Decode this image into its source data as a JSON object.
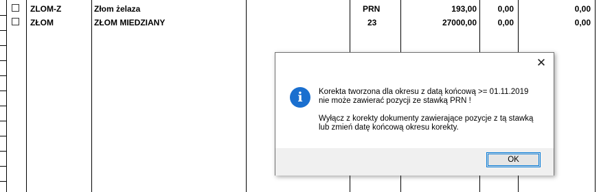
{
  "table": {
    "rows": [
      {
        "code": "ZLOM-Z",
        "name": "Złom żelaza",
        "rate": "PRN",
        "value": "193,00",
        "col6": "0,00",
        "col7": "0,00"
      },
      {
        "code": "ZŁOM",
        "name": "ZŁOM MIEDZIANY",
        "rate": "23",
        "value": "27000,00",
        "col6": "0,00",
        "col7": "0,00"
      }
    ]
  },
  "dialog": {
    "close_symbol": "✕",
    "icon": "info-icon",
    "line1": "Korekta tworzona dla okresu z datą końcową >= 01.11.2019",
    "line2": "nie może zawierać pozycji ze stawką PRN !",
    "line3": "Wyłącz z korekty dokumenty zawierające pozycje z tą stawką",
    "line4": "lub zmień datę końcową okresu korekty.",
    "ok_label": "OK",
    "accent": "#0078d7",
    "icon_color": "#1a6fcf"
  }
}
